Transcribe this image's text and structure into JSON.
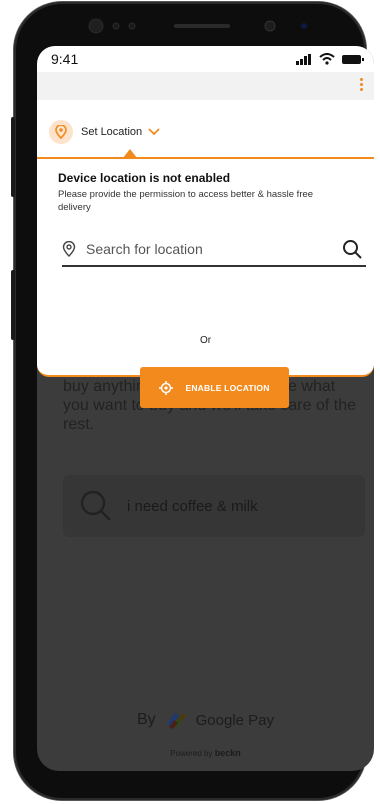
{
  "status_bar": {
    "time": "9:41"
  },
  "location_bar": {
    "label": "Set Location"
  },
  "popup": {
    "title": "Device location is not enabled",
    "message": "Please provide the permission to access better & hassle free delivery",
    "search_placeholder": "Search for location",
    "or_label": "Or",
    "enable_button": "ENABLE LOCATION"
  },
  "background": {
    "intro_text": "buy anything you need. Just type what you want to buy and we'll take care of the rest.",
    "query_example": "i need coffee & milk",
    "by_label": "By",
    "brand": "Google Pay",
    "powered_by": "Powered by",
    "powered_brand": "beckn"
  },
  "colors": {
    "accent": "#f28a1e",
    "overlay": "#3c3c3c"
  },
  "icons": [
    "location-pin-icon",
    "chevron-down-icon",
    "search-icon",
    "crosshair-icon",
    "kebab-menu-icon",
    "signal-icon",
    "wifi-icon",
    "battery-icon",
    "google-pay-logo"
  ]
}
